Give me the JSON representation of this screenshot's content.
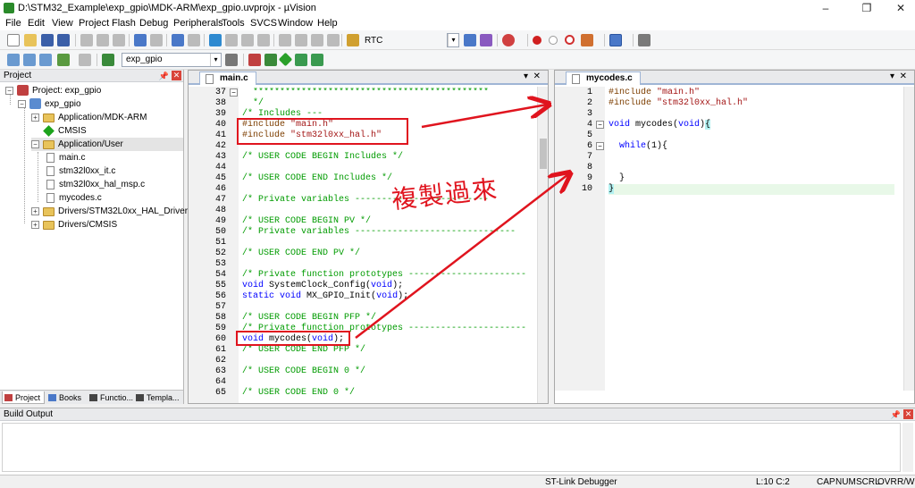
{
  "window": {
    "title": "D:\\STM32_Example\\exp_gpio\\MDK-ARM\\exp_gpio.uvprojx - µVision",
    "min_glyph": "–",
    "max_glyph": "❐",
    "close_glyph": "✕"
  },
  "menu": [
    "File",
    "Edit",
    "View",
    "Project",
    "Flash",
    "Debug",
    "Peripherals",
    "Tools",
    "SVCS",
    "Window",
    "Help"
  ],
  "toolbar": {
    "rtc_label": "RTC",
    "target_combo": "exp_gpio"
  },
  "project_panel": {
    "header": "Project",
    "tree": [
      {
        "label": "Project: exp_gpio",
        "level": 0
      },
      {
        "label": "exp_gpio",
        "level": 1
      },
      {
        "label": "Application/MDK-ARM",
        "level": 2
      },
      {
        "label": "CMSIS",
        "level": 2
      },
      {
        "label": "Application/User",
        "level": 2
      },
      {
        "label": "main.c",
        "level": 3
      },
      {
        "label": "stm32l0xx_it.c",
        "level": 3
      },
      {
        "label": "stm32l0xx_hal_msp.c",
        "level": 3
      },
      {
        "label": "mycodes.c",
        "level": 3
      },
      {
        "label": "Drivers/STM32L0xx_HAL_Driver",
        "level": 2
      },
      {
        "label": "Drivers/CMSIS",
        "level": 2
      }
    ],
    "tabs": [
      "Project",
      "Books",
      "Functio...",
      "Templa..."
    ]
  },
  "main_editor": {
    "tab": "main.c",
    "lines": [
      {
        "n": "37",
        "t": "  ********************************************"
      },
      {
        "n": "38",
        "t": "  */"
      },
      {
        "n": "39",
        "t": "/* Includes ---"
      },
      {
        "n": "40",
        "t": "#include \"main.h\""
      },
      {
        "n": "41",
        "t": "#include \"stm32l0xx_hal.h\""
      },
      {
        "n": "42",
        "t": ""
      },
      {
        "n": "43",
        "t": "/* USER CODE BEGIN Includes */"
      },
      {
        "n": "44",
        "t": ""
      },
      {
        "n": "45",
        "t": "/* USER CODE END Includes */"
      },
      {
        "n": "46",
        "t": ""
      },
      {
        "n": "47",
        "t": "/* Private variables -------------------------"
      },
      {
        "n": "48",
        "t": ""
      },
      {
        "n": "49",
        "t": "/* USER CODE BEGIN PV */"
      },
      {
        "n": "50",
        "t": "/* Private variables ------------------------------"
      },
      {
        "n": "51",
        "t": ""
      },
      {
        "n": "52",
        "t": "/* USER CODE END PV */"
      },
      {
        "n": "53",
        "t": ""
      },
      {
        "n": "54",
        "t": "/* Private function prototypes ----------------------"
      },
      {
        "n": "55",
        "t": "void SystemClock_Config(void);"
      },
      {
        "n": "56",
        "t": "static void MX_GPIO_Init(void);"
      },
      {
        "n": "57",
        "t": ""
      },
      {
        "n": "58",
        "t": "/* USER CODE BEGIN PFP */"
      },
      {
        "n": "59",
        "t": "/* Private function prototypes ----------------------"
      },
      {
        "n": "60",
        "t": "void mycodes(void);"
      },
      {
        "n": "61",
        "t": "/* USER CODE END PFP */"
      },
      {
        "n": "62",
        "t": ""
      },
      {
        "n": "63",
        "t": "/* USER CODE BEGIN 0 */"
      },
      {
        "n": "64",
        "t": ""
      },
      {
        "n": "65",
        "t": "/* USER CODE END 0 */"
      }
    ]
  },
  "second_editor": {
    "tab": "mycodes.c",
    "lines": [
      {
        "n": "1",
        "t": "#include \"main.h\""
      },
      {
        "n": "2",
        "t": "#include \"stm32l0xx_hal.h\""
      },
      {
        "n": "3",
        "t": ""
      },
      {
        "n": "4",
        "t": "void mycodes(void){"
      },
      {
        "n": "5",
        "t": ""
      },
      {
        "n": "6",
        "t": "  while(1){"
      },
      {
        "n": "7",
        "t": ""
      },
      {
        "n": "8",
        "t": ""
      },
      {
        "n": "9",
        "t": "  }"
      },
      {
        "n": "10",
        "t": "}"
      }
    ]
  },
  "annotation": {
    "text": "複製過來"
  },
  "build_output": {
    "header": "Build Output"
  },
  "status": {
    "debugger": "ST-Link Debugger",
    "position": "L:10 C:2",
    "cap": "CAP",
    "num": "NUM",
    "scrl": "SCRL",
    "ovr": "OVR",
    "rw": "R/W"
  },
  "colors": {
    "annotation_red": "#e0141e",
    "comment_green": "#009b00",
    "keyword_blue": "#0000ff",
    "string_red": "#a31515"
  }
}
